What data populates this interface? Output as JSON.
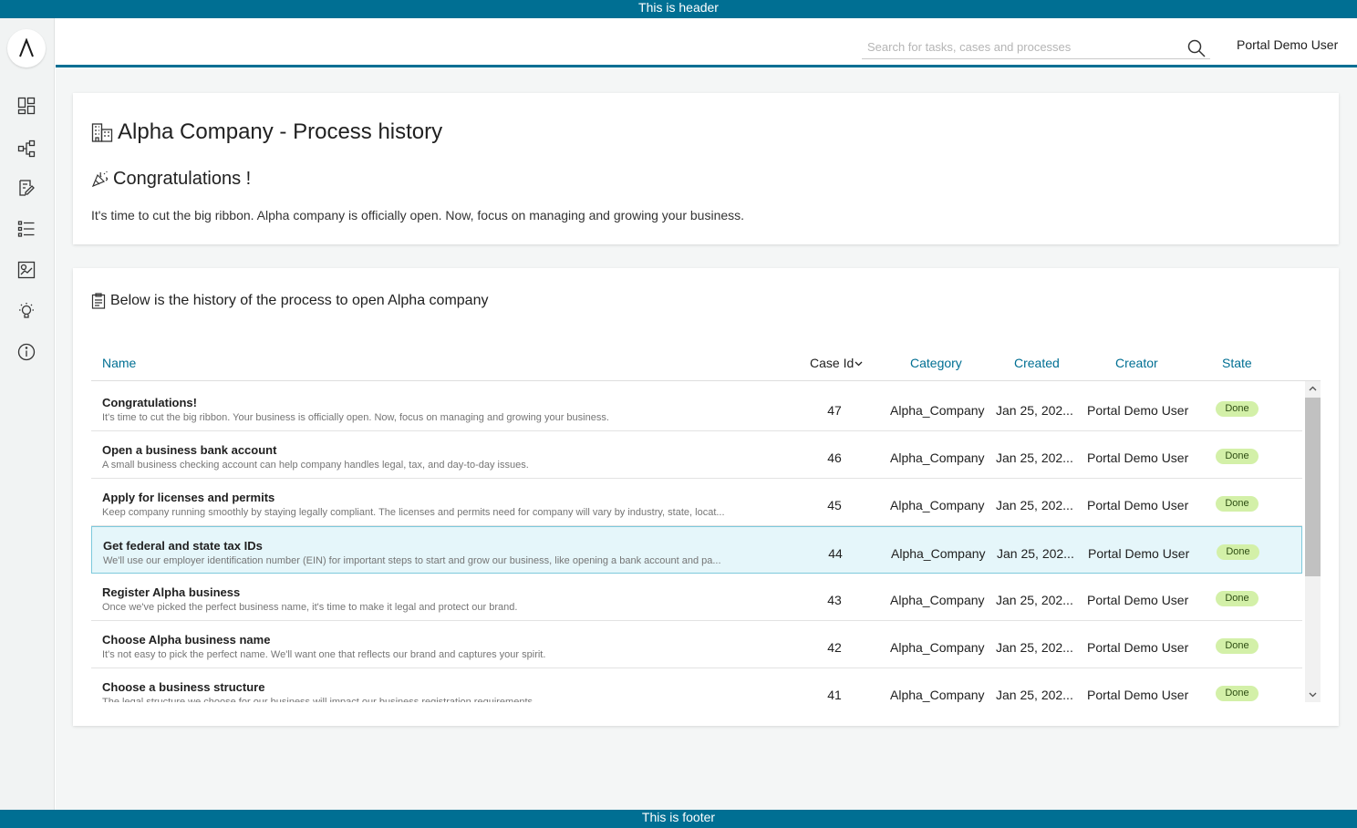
{
  "banners": {
    "header": "This is header",
    "footer": "This is footer"
  },
  "search": {
    "placeholder": "Search for tasks, cases and processes",
    "value": ""
  },
  "user": {
    "name": "Portal Demo User"
  },
  "sidebar": {
    "items": [
      {
        "icon": "dashboard-icon"
      },
      {
        "icon": "processes-icon"
      },
      {
        "icon": "tasks-icon"
      },
      {
        "icon": "cases-icon"
      },
      {
        "icon": "statistics-icon"
      },
      {
        "icon": "lightbulb-icon"
      },
      {
        "icon": "info-icon"
      }
    ]
  },
  "page": {
    "title": "Alpha Company - Process history",
    "congrats": "Congratulations !",
    "intro": "It's time to cut the big ribbon. Alpha company is officially open. Now, focus on managing and growing your business.",
    "history_title": "Below is the history of the process to open Alpha company"
  },
  "table": {
    "headers": {
      "name": "Name",
      "case_id": "Case Id",
      "category": "Category",
      "created": "Created",
      "creator": "Creator",
      "state": "State"
    },
    "rows": [
      {
        "name": "Congratulations!",
        "description": "It's time to cut the big ribbon. Your business is officially open. Now, focus on managing and growing your business.",
        "case_id": "47",
        "category": "Alpha_Company",
        "created": "Jan 25, 202...",
        "creator": "Portal Demo User",
        "state": "Done"
      },
      {
        "name": "Open a business bank account",
        "description": "A small business checking account can help company handles legal, tax, and day-to-day issues.",
        "case_id": "46",
        "category": "Alpha_Company",
        "created": "Jan 25, 202...",
        "creator": "Portal Demo User",
        "state": "Done"
      },
      {
        "name": "Apply for licenses and permits",
        "description": "Keep company running smoothly by staying legally compliant. The licenses and permits need for company will vary by industry, state, locat...",
        "case_id": "45",
        "category": "Alpha_Company",
        "created": "Jan 25, 202...",
        "creator": "Portal Demo User",
        "state": "Done"
      },
      {
        "name": "Get federal and state tax IDs",
        "description": "We'll use our employer identification number (EIN) for important steps to start and grow our business, like opening a bank account and pa...",
        "case_id": "44",
        "category": "Alpha_Company",
        "created": "Jan 25, 202...",
        "creator": "Portal Demo User",
        "state": "Done"
      },
      {
        "name": "Register Alpha business",
        "description": "Once we've picked the perfect business name, it's time to make it legal and protect our brand.",
        "case_id": "43",
        "category": "Alpha_Company",
        "created": "Jan 25, 202...",
        "creator": "Portal Demo User",
        "state": "Done"
      },
      {
        "name": "Choose Alpha business name",
        "description": "It's not easy to pick the perfect name. We'll want one that reflects our brand and captures your spirit.",
        "case_id": "42",
        "category": "Alpha_Company",
        "created": "Jan 25, 202...",
        "creator": "Portal Demo User",
        "state": "Done"
      },
      {
        "name": "Choose a business structure",
        "description": "The legal structure we choose for our business will impact our business registration requirements",
        "case_id": "41",
        "category": "Alpha_Company",
        "created": "Jan 25, 202...",
        "creator": "Portal Demo User",
        "state": "Done"
      }
    ],
    "selected_row": 3
  },
  "colors": {
    "primary": "#006f93",
    "done_badge": "#d3f0a8",
    "selected_row": "#e5f6fa"
  }
}
